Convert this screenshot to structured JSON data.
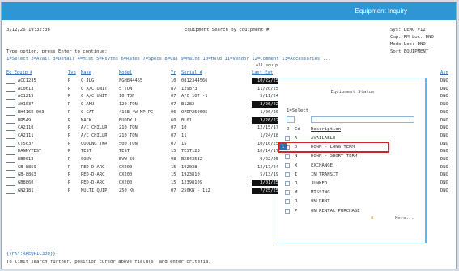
{
  "window": {
    "title": "Equipment Inquiry"
  },
  "header": {
    "datetime": "3/12/26 19:32:36",
    "screen_title": "Equipment Search by Equipment #",
    "sys": "Sys: DEMO V12",
    "cmp": "Cmp: RM Loc: DNO",
    "mode": "Mode Loc: DNO",
    "sort": "Sort EQUIPMENT"
  },
  "instructions": {
    "line1": "Type option, press Enter to continue:",
    "options": "1=Select 2=Avail 3=Detail 4=Hist 5=Rsvtns 6=Rates 7=Specs 8=Cal 9=Maint 10=Hold 11=Vendor 12=Comment 13=Accessories ...",
    "all_equip": "All equip"
  },
  "columns": {
    "equip": "Eq Equip #",
    "typ": "Typ",
    "make": "Make",
    "model": "Model",
    "yr": "Yr",
    "serial": "Serial #",
    "last": "Last Est",
    "asn": "Asn"
  },
  "rows": [
    {
      "equip": "ACC1235",
      "typ": "R",
      "make": "C JLG",
      "model": "FGH844455",
      "yr": "10",
      "serial": "0812344566",
      "last": "10/22/25",
      "dark": true,
      "asn": "DNO"
    },
    {
      "equip": "AC0613",
      "typ": "R",
      "make": "C A/C UNIT",
      "model": "5 TON",
      "yr": "87",
      "serial": "129873",
      "last": "11/20/25",
      "dark": false,
      "asn": "DNO"
    },
    {
      "equip": "AC1219",
      "typ": "R",
      "make": "C A/C UNIT",
      "model": "10 TON",
      "yr": "07",
      "serial": "A/C 10T -1",
      "last": "5/11/24",
      "dark": false,
      "asn": "DNO"
    },
    {
      "equip": "AH1037",
      "typ": "R",
      "make": "C AMU",
      "model": "120 TON",
      "yr": "07",
      "serial": "B1282",
      "last": "3/26/22",
      "dark": true,
      "asn": "DNO"
    },
    {
      "equip": "BH416E-003",
      "typ": "R",
      "make": "C CAT",
      "model": "416E 4W MP PC",
      "yr": "06",
      "serial": "OFDP250605",
      "last": "1/06/20",
      "dark": false,
      "asn": "DNO"
    },
    {
      "equip": "BR549",
      "typ": "R",
      "make": "MACK",
      "model": "BUDDY L",
      "yr": "60",
      "serial": "BL01",
      "last": "3/26/22",
      "dark": true,
      "asn": "DNO"
    },
    {
      "equip": "CA2110",
      "typ": "R",
      "make": "A/C CHILLR",
      "model": "210 TON",
      "yr": "07",
      "serial": "10",
      "last": "12/15/17",
      "dark": false,
      "asn": "DNO"
    },
    {
      "equip": "CA2111",
      "typ": "R",
      "make": "A/C CHILLR",
      "model": "210 TON",
      "yr": "07",
      "serial": "11",
      "last": "1/24/18",
      "dark": false,
      "asn": "DNO"
    },
    {
      "equip": "CT5037",
      "typ": "R",
      "make": "COOLNG TWR",
      "model": "500 TON",
      "yr": "07",
      "serial": "15",
      "last": "10/16/25",
      "dark": false,
      "asn": "DNO"
    },
    {
      "equip": "DANNYTEST",
      "typ": "R",
      "make": "TEST",
      "model": "TEST",
      "yr": "15",
      "serial": "TEST123",
      "last": "10/14/17",
      "dark": false,
      "asn": "DNO"
    },
    {
      "equip": "EB0013",
      "typ": "R",
      "make": "SONY",
      "model": "BVW-50",
      "yr": "98",
      "serial": "BX643532",
      "last": "9/22/05",
      "dark": false,
      "asn": "DNO"
    },
    {
      "equip": "GB-8859",
      "typ": "R",
      "make": "RED-D-ARC",
      "model": "GX200",
      "yr": "15",
      "serial": "192038",
      "last": "12/17/24",
      "dark": false,
      "asn": "DNO"
    },
    {
      "equip": "GB-8863",
      "typ": "R",
      "make": "RED-D-ARC",
      "model": "GX200",
      "yr": "15",
      "serial": "1923810",
      "last": "5/13/19",
      "dark": false,
      "asn": "DNO"
    },
    {
      "equip": "GB8860",
      "typ": "R",
      "make": "RED-D-ARC",
      "model": "GX200",
      "yr": "15",
      "serial": "12398109",
      "last": "3/01/25",
      "dark": true,
      "asn": "DNO"
    },
    {
      "equip": "GN2181",
      "typ": "R",
      "make": "MULTI QUIP",
      "model": "250 KW",
      "yr": "07",
      "serial": "250KW - 112",
      "last": "7/25/25",
      "dark": true,
      "asn": "DNO"
    }
  ],
  "popup": {
    "title": "Equipment Status",
    "select_label": "1=Select",
    "col_o": "O",
    "col_cd": "Cd",
    "col_desc": "Description",
    "items": [
      {
        "cd": "A",
        "desc": "AVAILABLE"
      },
      {
        "cd": "D",
        "desc": "DOWN - LONG TERM"
      },
      {
        "cd": "N",
        "desc": "DOWN - SHORT TERM"
      },
      {
        "cd": "X",
        "desc": "EXCHANGE"
      },
      {
        "cd": "I",
        "desc": "IN TRANSIT"
      },
      {
        "cd": "J",
        "desc": "JUNKED"
      },
      {
        "cd": "M",
        "desc": "MISSING"
      },
      {
        "cd": "R",
        "desc": "ON RENT"
      },
      {
        "cd": "P",
        "desc": "ON RENTAL PURCHASE"
      }
    ],
    "selected_value": "1",
    "more": "More...",
    "page_indicator": "8"
  },
  "footer": {
    "fkey": "{{FKY:RAEQPIC300}}",
    "hint": "To limit search further, position cursor above field(s) and enter criteria."
  },
  "colors": {
    "titlebar": "#2f96d6",
    "highlight_border": "#d0242b",
    "link": "#2f6fb5"
  }
}
